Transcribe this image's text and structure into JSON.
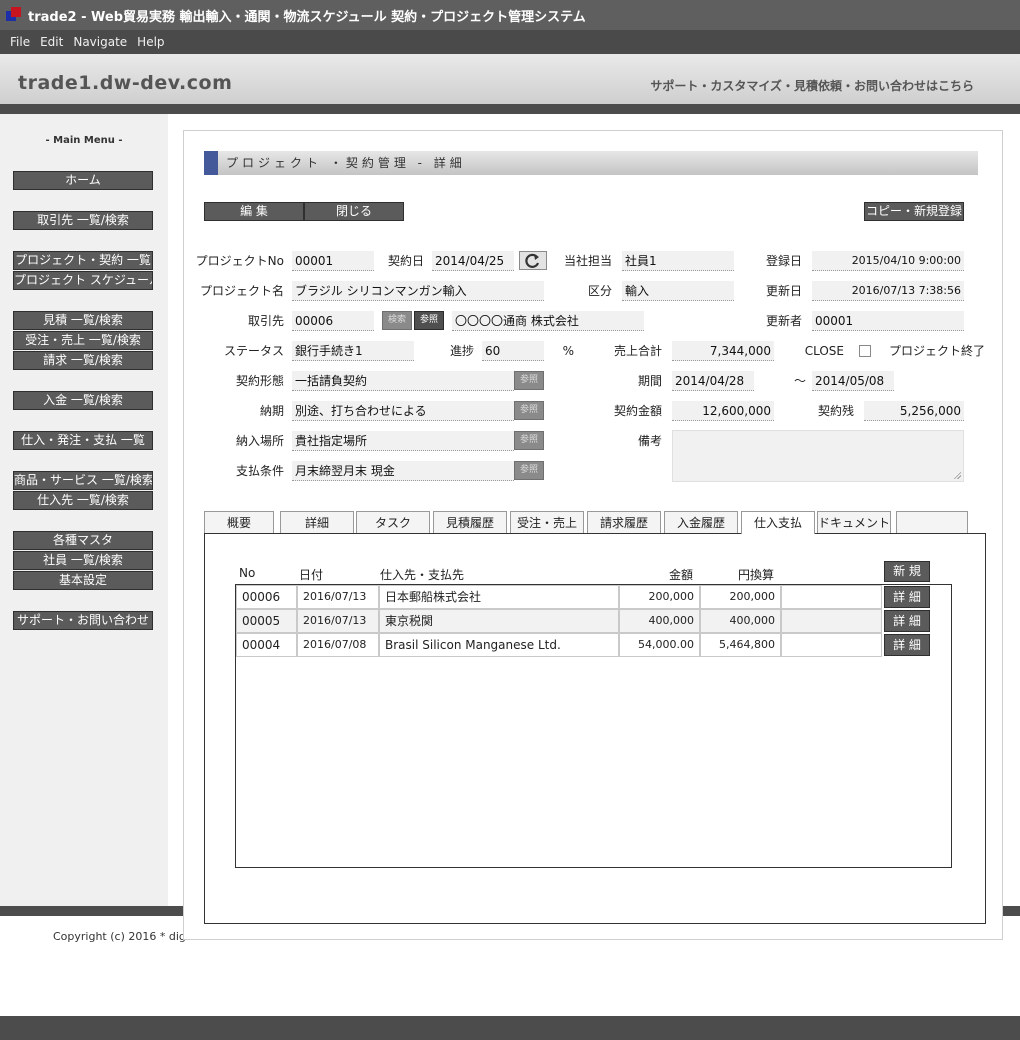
{
  "window": {
    "title": "trade2 - Web貿易実務 輸出輸入・通関・物流スケジュール 契約・プロジェクト管理システム"
  },
  "menubar": [
    "File",
    "Edit",
    "Navigate",
    "Help"
  ],
  "header": {
    "site": "trade1.dw-dev.com",
    "support": "サポート・カスタマイズ・見積依頼・お問い合わせはこちら"
  },
  "sidebar": {
    "heading": "- Main Menu -",
    "items": [
      "ホーム",
      "取引先 一覧/検索",
      "プロジェクト・契約 一覧",
      "プロジェクト スケジュール",
      "見積 一覧/検索",
      "受注・売上 一覧/検索",
      "請求 一覧/検索",
      "入金 一覧/検索",
      "仕入・発注・支払 一覧",
      "商品・サービス 一覧/検索",
      "仕入先 一覧/検索",
      "各種マスタ",
      "社員 一覧/検索",
      "基本設定",
      "サポート・お問い合わせ"
    ]
  },
  "footer": {
    "copyright": "Copyright (c) 2016 * dig"
  },
  "page": {
    "section_title": "プロジェクト ・契約管理 - 詳細",
    "buttons": {
      "edit": "編 集",
      "close": "閉じる",
      "copy_new": "コピー・新規登録",
      "ref": "参照",
      "search": "検索"
    },
    "labels": {
      "project_no": "プロジェクトNo",
      "contract_date": "契約日",
      "staff": "当社担当",
      "reg_date": "登録日",
      "project_name": "プロジェクト名",
      "category": "区分",
      "upd_date": "更新日",
      "client": "取引先",
      "updater": "更新者",
      "status": "ステータス",
      "progress": "進捗",
      "percent": "%",
      "sales_total": "売上合計",
      "close": "CLOSE",
      "project_end": "プロジェクト終了",
      "contract_type": "契約形態",
      "period": "期間",
      "tilde": "～",
      "delivery": "納期",
      "contract_amount": "契約金額",
      "contract_balance": "契約残",
      "delivery_place": "納入場所",
      "remarks": "備考",
      "payment_terms": "支払条件"
    },
    "values": {
      "project_no": "00001",
      "contract_date": "2014/04/25",
      "staff": "社員1",
      "reg_date": "2015/04/10 9:00:00",
      "project_name": "ブラジル シリコンマンガン輸入",
      "category": "輸入",
      "upd_date": "2016/07/13 7:38:56",
      "client_code": "00006",
      "client_name": "〇〇〇〇通商 株式会社",
      "updater": "00001",
      "status": "銀行手続き1",
      "progress": "60",
      "sales_total": "7,344,000",
      "contract_type": "一括請負契約",
      "period_from": "2014/04/28",
      "period_to": "2014/05/08",
      "delivery": "別途、打ち合わせによる",
      "contract_amount": "12,600,000",
      "contract_balance": "5,256,000",
      "delivery_place": "貴社指定場所",
      "payment_terms": "月末締翌月末 現金"
    },
    "tabs": [
      {
        "label": "概要",
        "active": false
      },
      {
        "label": "詳細",
        "active": false
      },
      {
        "label": "タスク",
        "active": false
      },
      {
        "label": "見積履歴",
        "active": false
      },
      {
        "label": "受注・売上",
        "active": false
      },
      {
        "label": "請求履歴",
        "active": false
      },
      {
        "label": "入金履歴",
        "active": false
      },
      {
        "label": "仕入支払",
        "active": true
      },
      {
        "label": "ドキュメント",
        "active": false
      },
      {
        "label": "",
        "active": false
      }
    ],
    "table": {
      "headers": {
        "no": "No",
        "date": "日付",
        "supplier": "仕入先・支払先",
        "amount": "金額",
        "yen": "円換算"
      },
      "new_button": "新 規",
      "detail_button": "詳 細",
      "rows": [
        {
          "no": "00006",
          "date": "2016/07/13",
          "supplier": "日本郵船株式会社",
          "amount": "200,000",
          "yen": "200,000"
        },
        {
          "no": "00005",
          "date": "2016/07/13",
          "supplier": "東京税関",
          "amount": "400,000",
          "yen": "400,000"
        },
        {
          "no": "00004",
          "date": "2016/07/08",
          "supplier": "Brasil Silicon Manganese Ltd.",
          "amount": "54,000.00",
          "yen": "5,464,800"
        }
      ]
    }
  }
}
